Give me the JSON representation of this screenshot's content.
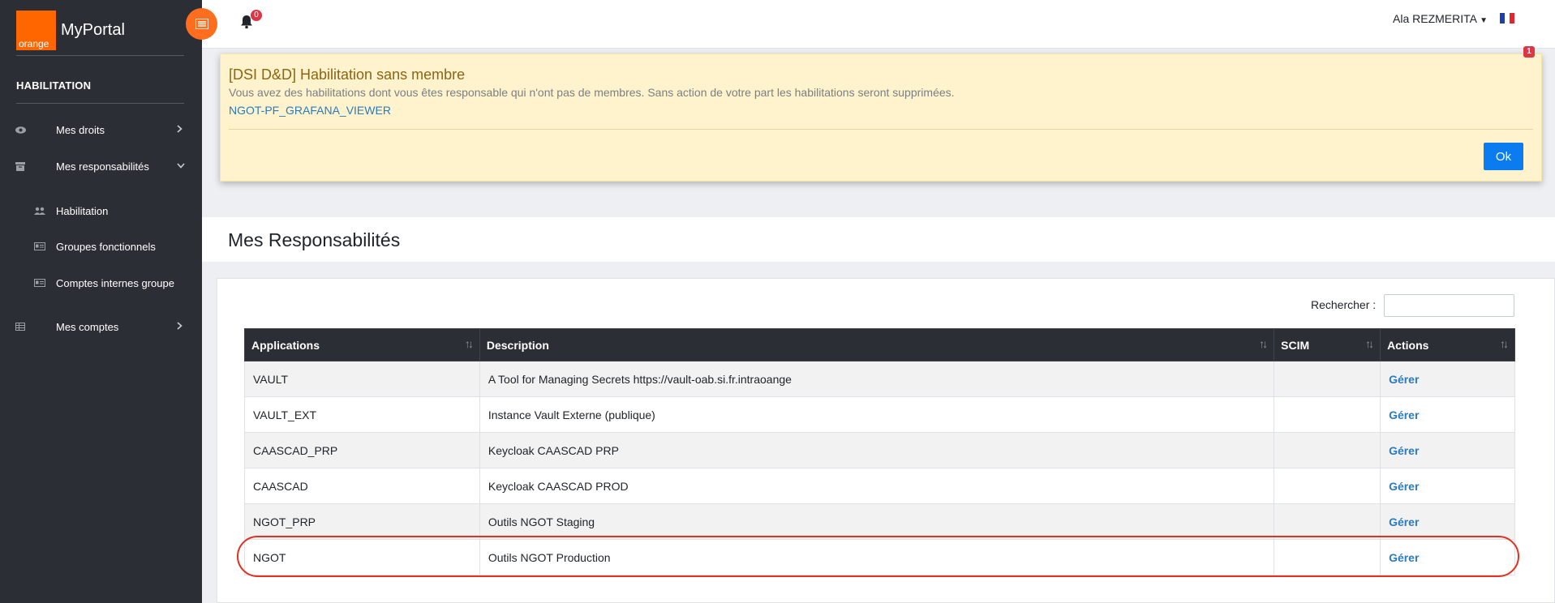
{
  "brand": {
    "logo_text": "orange",
    "app_name": "MyPortal",
    "accent": "#ff6600"
  },
  "sidebar": {
    "section_title": "HABILITATION",
    "items": [
      {
        "label": "Mes droits",
        "icon": "eye-icon"
      },
      {
        "label": "Mes responsabilités",
        "icon": "archive-icon"
      },
      {
        "label": "Habilitation",
        "icon": "users-icon"
      },
      {
        "label": "Groupes fonctionnels",
        "icon": "id-card-icon"
      },
      {
        "label": "Comptes internes groupe",
        "icon": "id-card-icon"
      },
      {
        "label": "Mes comptes",
        "icon": "table-icon"
      }
    ]
  },
  "header": {
    "notification_count": "0",
    "user_name": "Ala REZMERITA",
    "language_flag": "fr-flag-icon"
  },
  "alert": {
    "title": "[DSI D&D] Habilitation sans membre",
    "message": "Vous avez des habilitations dont vous êtes responsable qui n'ont pas de membres. Sans action de votre part les habilitations seront supprimées.",
    "link": "NGOT-PF_GRAFANA_VIEWER",
    "ok_label": "Ok",
    "badge": "1"
  },
  "page": {
    "title": "Mes Responsabilités"
  },
  "search": {
    "label": "Rechercher :",
    "value": ""
  },
  "table": {
    "headers": [
      "Applications",
      "Description",
      "SCIM",
      "Actions"
    ],
    "rows": [
      {
        "application": "VAULT",
        "description": "A Tool for Managing Secrets https://vault-oab.si.fr.intraoange",
        "scim": "",
        "action": "Gérer"
      },
      {
        "application": "VAULT_EXT",
        "description": "Instance Vault Externe (publique)",
        "scim": "",
        "action": "Gérer"
      },
      {
        "application": "CAASCAD_PRP",
        "description": "Keycloak CAASCAD PRP",
        "scim": "",
        "action": "Gérer"
      },
      {
        "application": "CAASCAD",
        "description": "Keycloak CAASCAD PROD",
        "scim": "",
        "action": "Gérer"
      },
      {
        "application": "NGOT_PRP",
        "description": "Outils NGOT Staging",
        "scim": "",
        "action": "Gérer"
      },
      {
        "application": "NGOT",
        "description": "Outils NGOT Production",
        "scim": "",
        "action": "Gérer"
      }
    ]
  },
  "colors": {
    "sidebar_bg": "#2b2f35",
    "link": "#2a7bc0",
    "primary_button": "#0b7bf0",
    "alert_bg": "#fff3cd",
    "highlight": "#e3301f"
  }
}
